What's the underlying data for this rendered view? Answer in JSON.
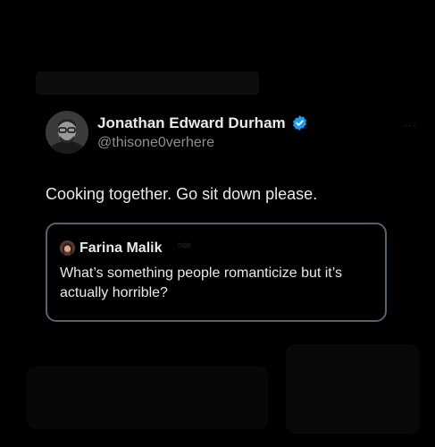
{
  "tweet": {
    "author_name": "Jonathan Edward Durham",
    "author_handle": "@thisone0verhere",
    "text": "Cooking together. Go sit down please.",
    "more_label": "···"
  },
  "quote": {
    "author_name": "Farina Malik",
    "faint_label": "nde",
    "text": "What’s something people romanticize but it’s actually horrible?"
  },
  "colors": {
    "background": "#000000",
    "verified_badge": "#1d9bf0",
    "card_border": "#536471",
    "secondary_text": "#8b8f93"
  },
  "icons": [
    "avatar",
    "verified-badge-icon",
    "more-options-icon",
    "quoted-avatar"
  ]
}
